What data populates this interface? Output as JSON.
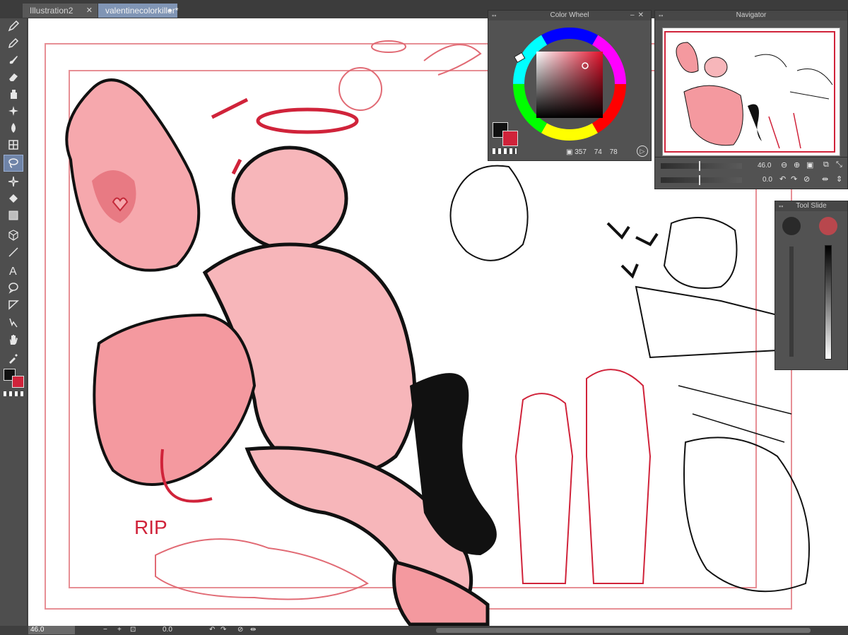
{
  "tabs": [
    {
      "label": "Illustration2",
      "close": "✕"
    },
    {
      "label": "valentinecolorkiller*",
      "close": "●"
    }
  ],
  "toolbar": {
    "tools": [
      "pen-icon",
      "pencil-icon",
      "brush-icon",
      "eraser-icon",
      "paint-icon",
      "sparkle-icon",
      "blend-icon",
      "grid-icon",
      "lasso-select-icon",
      "auto-select-icon",
      "fill-icon",
      "gradient-icon",
      "3d-figure-icon",
      "line-icon",
      "text-icon",
      "speech-balloon-icon",
      "ruler-icon",
      "correct-line-icon",
      "hand-icon",
      "eyedropper-icon"
    ],
    "active_tool": "lasso-select-icon"
  },
  "colors": {
    "main": "#111111",
    "sub": "#d0233a",
    "accent": "#8095b5"
  },
  "color_wheel": {
    "title": "Color Wheel",
    "hue": "357",
    "saturation": "74",
    "value": "78",
    "selected_color": "#c9343f"
  },
  "navigator": {
    "title": "Navigator",
    "zoom": "46.0",
    "rotation": "0.0"
  },
  "tool_slider": {
    "title": "Tool Slide"
  },
  "canvas": {
    "annotation": "RIP"
  },
  "status": {
    "zoom": "46.0",
    "zoom_out": "−",
    "zoom_in": "+",
    "fit": "⊡",
    "rotation": "0.0"
  }
}
